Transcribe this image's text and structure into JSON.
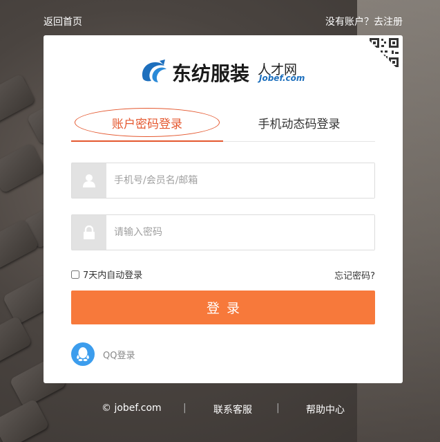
{
  "nav": {
    "back_label": "返回首页",
    "register_label": "没有账户？去注册"
  },
  "logo": {
    "brand": "东纺服装",
    "sub": "人才网",
    "domain": "Jobef.com"
  },
  "tabs": {
    "account_login": "账户密码登录",
    "mobile_login": "手机动态码登录"
  },
  "form": {
    "username_placeholder": "手机号/会员名/邮箱",
    "username_value": "",
    "password_placeholder": "请输入密码",
    "password_value": "",
    "remember_label": "7天内自动登录",
    "remember_checked": false,
    "forgot_label": "忘记密码?",
    "login_button": "登录"
  },
  "social": {
    "qq_label": "QQ登录"
  },
  "footer": {
    "copyright": "© jobef.com",
    "service": "联系客服",
    "help": "帮助中心"
  },
  "colors": {
    "accent": "#e4572e",
    "button": "#f7793b",
    "qq": "#3c9ded",
    "brand_blue": "#1d6fbd"
  },
  "icons": {
    "username": "user-icon",
    "password": "lock-icon",
    "qq": "qq-icon",
    "qr": "qr-code-icon"
  }
}
